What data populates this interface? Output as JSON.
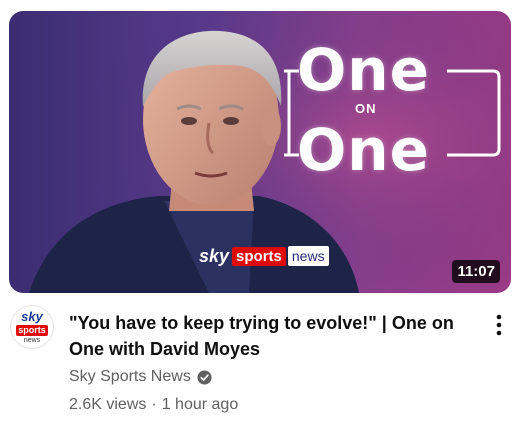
{
  "video": {
    "title": "\"You have to keep trying to evolve!\" | One on One with David Moyes",
    "duration": "11:07",
    "views": "2.6K views",
    "separator": "·",
    "age": "1 hour ago"
  },
  "thumbnail": {
    "one_top": "One",
    "on_word": "ON",
    "one_bottom": "One",
    "brand_sky": "sky",
    "brand_sports": "sports",
    "brand_news": "news"
  },
  "channel": {
    "name": "Sky Sports News",
    "avatar_sky": "sky",
    "avatar_sports": "sports",
    "avatar_news": "news",
    "verified_icon": "verified-check-icon"
  },
  "menu": {
    "icon": "more-vertical-icon"
  },
  "colors": {
    "brand_red": "#e10a0a",
    "sky_blue": "#1c3f95",
    "text_primary": "#0f0f0f",
    "text_secondary": "#606060",
    "thumb_bg_left": "#3a2e72",
    "thumb_bg_right": "#9c3a86"
  }
}
